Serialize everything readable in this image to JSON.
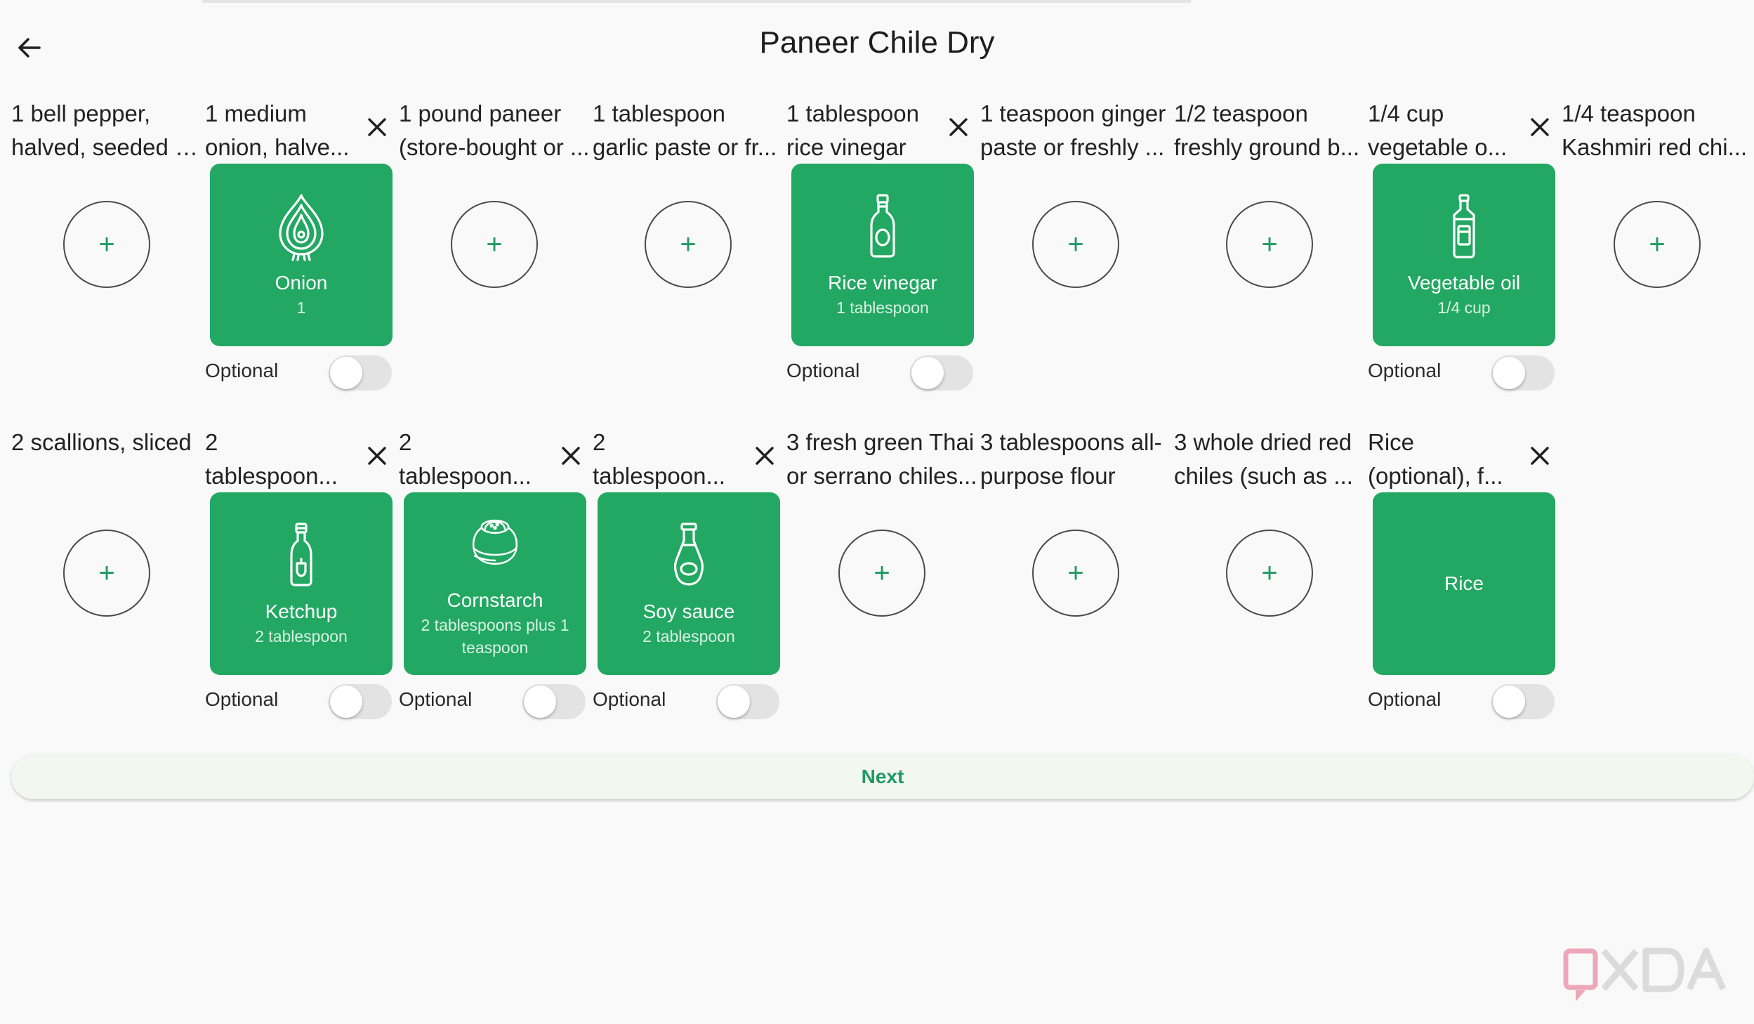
{
  "header": {
    "title": "Paneer Chile Dry"
  },
  "optional_label": "Optional",
  "next_label": "Next",
  "watermark": "XDA",
  "colors": {
    "accent": "#22a862",
    "background": "#f9f9f9",
    "toggle_off": "#e3e3e3"
  },
  "row1": [
    {
      "desc": [
        "1 bell pepper,",
        "halved, seeded a..."
      ],
      "add": "+"
    },
    {
      "desc": [
        "1 medium",
        "onion, halve..."
      ],
      "card": {
        "name": "Onion",
        "qty": "1",
        "icon": "onion-icon"
      }
    },
    {
      "desc": [
        "1 pound paneer",
        "(store-bought or ..."
      ],
      "add": "+"
    },
    {
      "desc": [
        "1 tablespoon",
        "garlic paste or fr..."
      ],
      "add": "+"
    },
    {
      "desc": [
        "1 tablespoon",
        "rice vinegar"
      ],
      "card": {
        "name": "Rice vinegar",
        "qty": "1 tablespoon",
        "icon": "rice-vinegar-icon"
      }
    },
    {
      "desc": [
        "1 teaspoon ginger",
        "paste or freshly ..."
      ],
      "add": "+"
    },
    {
      "desc": [
        "1/2 teaspoon",
        "freshly ground b..."
      ],
      "add": "+"
    },
    {
      "desc": [
        "1/4 cup",
        "vegetable o..."
      ],
      "card": {
        "name": "Vegetable oil",
        "qty": "1/4 cup",
        "icon": "vegetable-oil-icon"
      }
    },
    {
      "desc": [
        "1/4 teaspoon",
        "Kashmiri red chi..."
      ],
      "add": "+"
    }
  ],
  "row2": [
    {
      "desc": [
        "2 scallions, sliced"
      ],
      "add": "+"
    },
    {
      "desc": [
        "2",
        "tablespoon..."
      ],
      "card": {
        "name": "Ketchup",
        "qty": "2 tablespoon",
        "icon": "ketchup-icon"
      }
    },
    {
      "desc": [
        "2",
        "tablespoon..."
      ],
      "card": {
        "name": "Cornstarch",
        "qty": "2 tablespoons plus 1 teaspoon",
        "icon": "cornstarch-icon"
      }
    },
    {
      "desc": [
        "2",
        "tablespoon..."
      ],
      "card": {
        "name": "Soy sauce",
        "qty": "2 tablespoon",
        "icon": "soy-sauce-icon"
      }
    },
    {
      "desc": [
        "3 fresh green Thai",
        "or serrano chiles..."
      ],
      "add": "+"
    },
    {
      "desc": [
        "3 tablespoons all-",
        "purpose flour"
      ],
      "add": "+"
    },
    {
      "desc": [
        "3 whole dried red",
        "chiles (such as ..."
      ],
      "add": "+"
    },
    {
      "desc": [
        "Rice",
        "(optional), f..."
      ],
      "card": {
        "name": "Rice",
        "qty": "",
        "icon": ""
      }
    }
  ]
}
